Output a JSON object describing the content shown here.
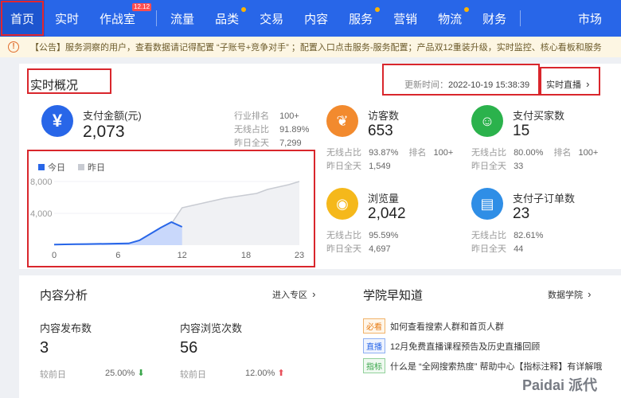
{
  "nav": {
    "items": [
      "首页",
      "实时",
      "作战室",
      "流量",
      "品类",
      "交易",
      "内容",
      "服务",
      "营销",
      "物流",
      "财务",
      "市场"
    ],
    "badge": "12.12"
  },
  "notice": {
    "text": "【公告】服务洞察的用户，查看数据请记得配置 “子账号+竞争对手” ；配置入口点击服务-服务配置；产品双12重装升级，实时监控、核心看板和服务"
  },
  "realtime": {
    "title": "实时概况",
    "update_label": "更新时间：",
    "update_time": "2022-10-19 15:38:39",
    "live_link": "实时直播",
    "payment": {
      "label": "支付金额(元)",
      "value": "2,073",
      "stats": [
        {
          "k": "行业排名",
          "v": "100+"
        },
        {
          "k": "无线占比",
          "v": "91.89%"
        },
        {
          "k": "昨日全天",
          "v": "7,299"
        }
      ]
    },
    "metrics": [
      {
        "label": "访客数",
        "value": "653",
        "l1": "无线占比",
        "v1": "93.87%",
        "l2": "排名",
        "v2": "100+",
        "l3": "昨日全天",
        "v3": "1,549"
      },
      {
        "label": "支付买家数",
        "value": "15",
        "l1": "无线占比",
        "v1": "80.00%",
        "l2": "排名",
        "v2": "100+",
        "l3": "昨日全天",
        "v3": "33"
      },
      {
        "label": "浏览量",
        "value": "2,042",
        "l1": "无线占比",
        "v1": "95.59%",
        "l2": "",
        "v2": "",
        "l3": "昨日全天",
        "v3": "4,697"
      },
      {
        "label": "支付子订单数",
        "value": "23",
        "l1": "无线占比",
        "v1": "82.61%",
        "l2": "",
        "v2": "",
        "l3": "昨日全天",
        "v3": "44"
      }
    ]
  },
  "chart_data": {
    "type": "area",
    "series": [
      {
        "name": "今日",
        "color": "#2866e8",
        "x": [
          0,
          1,
          2,
          3,
          4,
          5,
          6,
          7,
          8,
          9,
          10,
          11,
          12
        ],
        "values": [
          80,
          100,
          120,
          140,
          160,
          180,
          200,
          220,
          600,
          1400,
          2200,
          2900,
          2300
        ]
      },
      {
        "name": "昨日",
        "color": "#c8cbd2",
        "x": [
          0,
          1,
          2,
          3,
          4,
          5,
          6,
          7,
          8,
          9,
          10,
          11,
          12,
          13,
          14,
          15,
          16,
          17,
          18,
          19,
          20,
          21,
          22,
          23
        ],
        "values": [
          60,
          80,
          100,
          120,
          140,
          160,
          180,
          210,
          500,
          1300,
          2200,
          2700,
          4700,
          5000,
          5300,
          5600,
          5900,
          6100,
          6300,
          6500,
          7000,
          7300,
          7600,
          8000
        ]
      }
    ],
    "xticks": [
      "0",
      "6",
      "12",
      "18",
      "23"
    ],
    "yticks": [
      "8,000",
      "4,000"
    ],
    "xlim": [
      0,
      23
    ],
    "ylim": [
      0,
      8000
    ]
  },
  "content": {
    "title": "内容分析",
    "link": "进入专区",
    "metrics": [
      {
        "label": "内容发布数",
        "value": "3",
        "cmp": "较前日",
        "pct": "25.00%"
      },
      {
        "label": "内容浏览次数",
        "value": "56",
        "cmp": "较前日",
        "pct": "12.00%"
      }
    ]
  },
  "academy": {
    "title": "学院早知道",
    "link": "数据学院",
    "items": [
      {
        "tag": "必看",
        "text": "如何查看搜索人群和首页人群"
      },
      {
        "tag": "直播",
        "text": "12月免费直播课程预告及历史直播回顾"
      },
      {
        "tag": "指标",
        "text": "什么是 “全网搜索热度” 帮助中心【指标注释】有详解哦"
      }
    ]
  },
  "watermark": "Paidai 派代",
  "colors": {
    "nav_bg": "#2866e8",
    "highlight": "#d9262c",
    "up": "#39a54a",
    "down": "#e8505b",
    "payment_icon": "#2866e8",
    "visitor_icon": "#f28a2e",
    "buyer_icon": "#2bb24c",
    "pv_icon": "#f5b81b",
    "order_icon": "#2f8ee6"
  }
}
